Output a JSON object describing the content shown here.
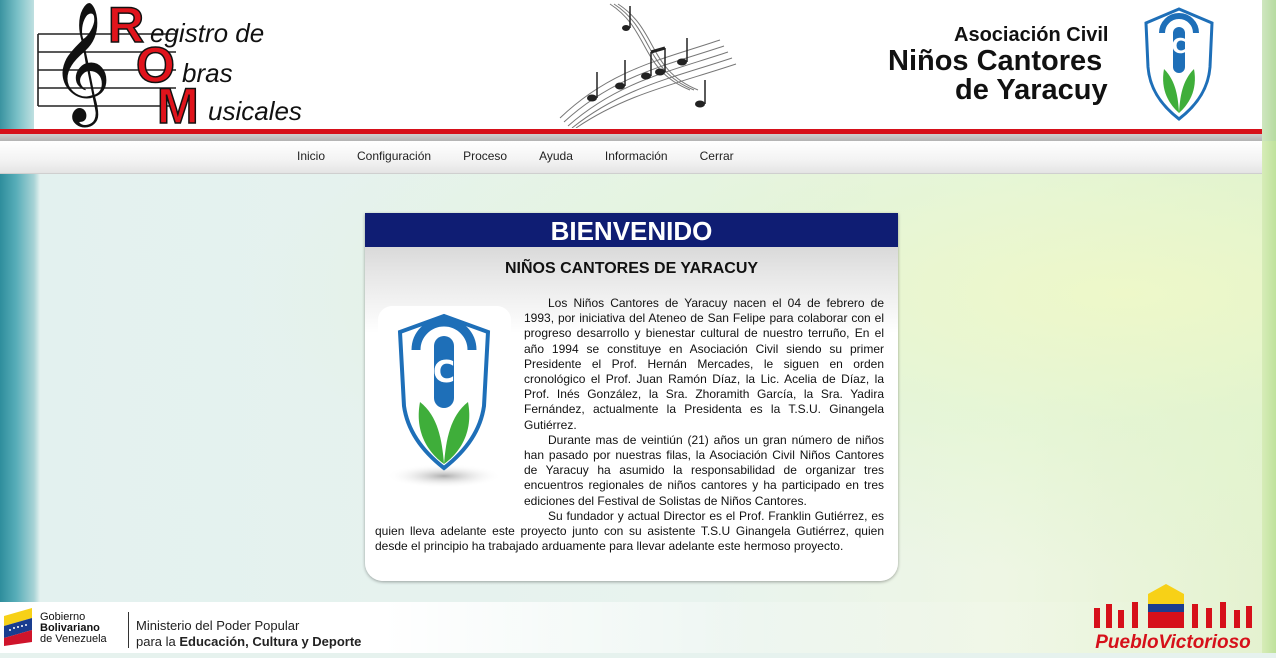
{
  "header": {
    "rom_logo": {
      "letters": [
        "R",
        "O",
        "M"
      ],
      "words": [
        "egistro de",
        "bras",
        "usicales"
      ]
    },
    "association": {
      "line1": "Asociación Civil",
      "line2": "Niños Cantores",
      "line3": "de Yaracuy"
    }
  },
  "nav": {
    "items": [
      "Inicio",
      "Configuración",
      "Proceso",
      "Ayuda",
      "Información",
      "Cerrar"
    ]
  },
  "card": {
    "title": "BIENVENIDO",
    "subtitle": "NIÑOS CANTORES DE YARACUY",
    "paragraphs": [
      "Los Niños Cantores de Yaracuy nacen el 04 de febrero de 1993, por iniciativa del Ateneo de San Felipe para colaborar con el progreso desarrollo y bienestar cultural de nuestro terruño, En el año 1994 se constituye en Asociación Civil siendo su primer Presidente el Prof. Hernán Mercades, le siguen en orden cronológico el Prof. Juan Ramón Díaz, la Lic. Acelia de Díaz, la Prof. Inés González, la Sra. Zhoramith García, la Sra. Yadira Fernández, actualmente la Presidenta es la T.S.U. Ginangela Gutiérrez.",
      "Durante mas de veintiún (21) años un gran número de niños han pasado por nuestras filas, la Asociación Civil Niños Cantores de Yaracuy ha asumido la responsabilidad de organizar tres encuentros regionales de niños cantores y ha participado en tres ediciones del Festival de Solistas de Niños Cantores.",
      "Su fundador y actual Director es el Prof. Franklin Gutiérrez, es quien lleva adelante este proyecto junto con su asistente T.S.U Ginangela Gutiérrez, quien desde el principio ha trabajado arduamente para llevar adelante este hermoso proyecto."
    ]
  },
  "footer": {
    "gov_line1": "Gobierno",
    "gov_line2": "Bolivariano",
    "gov_line3": "de Venezuela",
    "ministry_line1": "Ministerio del Poder Popular",
    "ministry_line2_prefix": "para la ",
    "ministry_line2_bold": "Educación, Cultura y Deporte",
    "pueblo_logo_text": "PuebloVictorioso"
  },
  "colors": {
    "card_header": "#0f1d73",
    "header_rule": "#d6101a",
    "rom_red": "#e0141c",
    "crest_blue": "#1e6fb8",
    "crest_green": "#3fae3a"
  },
  "icons": [
    "treble-clef-icon",
    "music-notes-icon",
    "crest-icon",
    "venezuela-flag-icon"
  ]
}
